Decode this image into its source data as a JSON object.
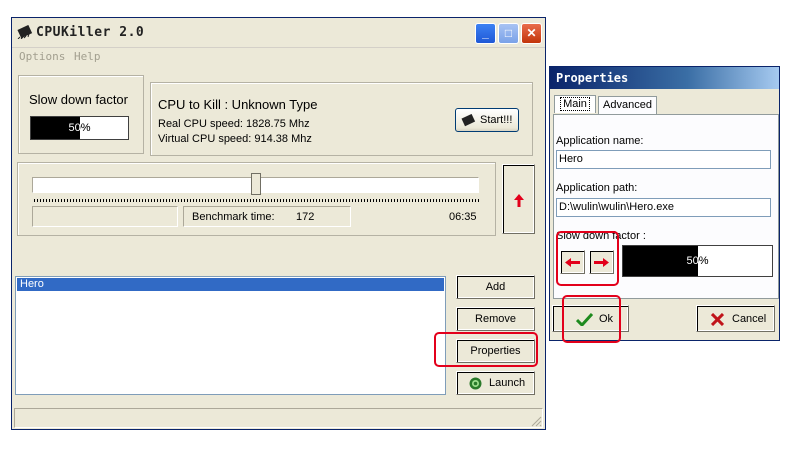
{
  "main_window": {
    "title": "CPUKiller 2.0",
    "menu": [
      "Options",
      "Help"
    ],
    "title_buttons": {
      "minimize": "_",
      "maximize": "□",
      "close": "✕"
    }
  },
  "slowdown": {
    "label": "Slow down factor",
    "value_text": "50%",
    "fraction": 0.5
  },
  "cpu_info": {
    "heading": "CPU to Kill : Unknown Type",
    "real_speed": "Real CPU speed: 1828.75 Mhz",
    "virtual_speed": "Virtual CPU speed: 914.38 Mhz",
    "start_label": "Start!!!"
  },
  "benchmark": {
    "label": "Benchmark time:",
    "value": "172",
    "time": "06:35",
    "trackbar_fraction": 0.5
  },
  "apps": {
    "items": [
      "Hero"
    ],
    "selected_index": 0
  },
  "buttons": {
    "add": "Add",
    "remove": "Remove",
    "properties": "Properties",
    "launch": "Launch"
  },
  "properties": {
    "title": "Properties",
    "tabs": [
      "Main",
      "Advanced"
    ],
    "active_tab": "Main",
    "app_name_label": "Application name:",
    "app_name_value": "Hero",
    "app_path_label": "Application path:",
    "app_path_value": "D:\\wulin\\wulin\\Hero.exe",
    "slowdown_label": "Slow down factor :",
    "slowdown_value_text": "50%",
    "slowdown_fraction": 0.5,
    "ok_label": "Ok",
    "cancel_label": "Cancel"
  },
  "colors": {
    "highlight": "#e3001b",
    "selection": "#316ac5",
    "window_bg": "#ece9d8"
  }
}
